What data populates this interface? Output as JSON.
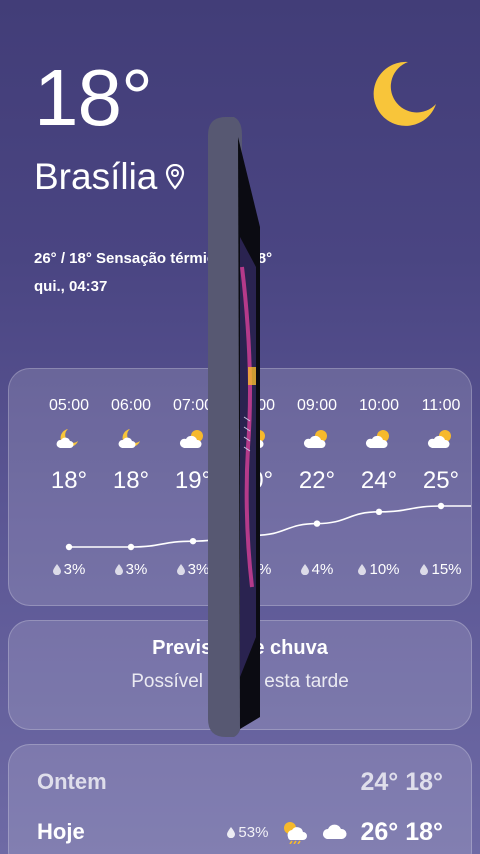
{
  "current": {
    "temperature": "18°",
    "city": "Brasília",
    "range_feels": "26° / 18° Sensação térmica de 18°",
    "datetime": "qui., 04:37",
    "condition_icon": "moon-icon"
  },
  "hourly": [
    {
      "time": "05:00",
      "icon": "moon-cloud-icon",
      "temp": "18°",
      "precip": "3%",
      "temp_value": 18
    },
    {
      "time": "06:00",
      "icon": "moon-cloud-icon",
      "temp": "18°",
      "precip": "3%",
      "temp_value": 18
    },
    {
      "time": "07:00",
      "icon": "sun-cloud-icon",
      "temp": "19°",
      "precip": "3%",
      "temp_value": 19
    },
    {
      "time": "08:00",
      "icon": "sun-cloud-icon",
      "temp": "20°",
      "precip": "3%",
      "temp_value": 20
    },
    {
      "time": "09:00",
      "icon": "sun-cloud-icon",
      "temp": "22°",
      "precip": "4%",
      "temp_value": 22
    },
    {
      "time": "10:00",
      "icon": "sun-cloud-icon",
      "temp": "24°",
      "precip": "10%",
      "temp_value": 24
    },
    {
      "time": "11:00",
      "icon": "sun-cloud-icon",
      "temp": "25°",
      "precip": "15%",
      "temp_value": 25
    }
  ],
  "rain_card": {
    "title": "Previsão de chuva",
    "subtitle": "Possível chuva esta tarde"
  },
  "daily": [
    {
      "day": "Ontem",
      "temps": "24° 18°"
    },
    {
      "day": "Hoje",
      "precip": "53%",
      "temps": "26° 18°",
      "icon_day": "sun-rain-cloud-icon",
      "icon_night": "cloud-icon"
    }
  ],
  "colors": {
    "moon": "#f8c53a",
    "sun": "#f6b92c",
    "cloud": "#ffffff"
  }
}
